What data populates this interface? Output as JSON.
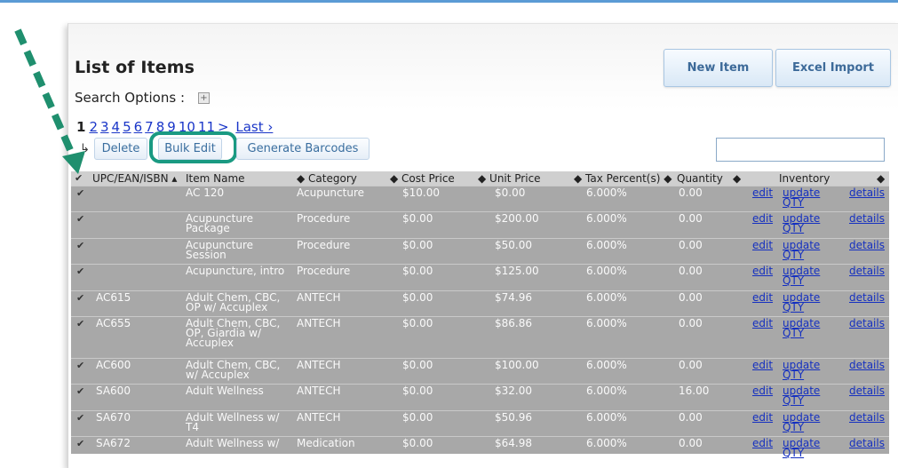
{
  "page": {
    "title": "List of Items",
    "search_options_label": "Search Options :",
    "search_toggle": "+",
    "new_item_button": "New Item",
    "excel_import_button": "Excel Import",
    "search_value": ""
  },
  "pagination": {
    "current": "1",
    "pages": [
      "2",
      "3",
      "4",
      "5",
      "6",
      "7",
      "8",
      "9",
      "10",
      "11"
    ],
    "next": ">",
    "last": "Last ›"
  },
  "actions": {
    "delete": "Delete",
    "bulk_edit": "Bulk Edit",
    "generate_barcodes": "Generate Barcodes"
  },
  "table": {
    "headers": {
      "check": "✔",
      "upc": "UPC/EAN/ISBN ▴",
      "item_name": "Item Name",
      "category": "◆ Category",
      "cost_price": "◆ Cost Price",
      "unit_price": "◆ Unit Price",
      "tax": "◆ Tax Percent(s) ◆",
      "quantity": "Quantity",
      "quantity_sort": "◆",
      "inventory": "Inventory",
      "inventory_sort": "◆"
    },
    "link_labels": {
      "edit": "edit",
      "update": "update",
      "qty": "QTY",
      "details": "details"
    },
    "rows": [
      {
        "upc": "",
        "name1": "AC 120",
        "name2": "",
        "name3": "",
        "category": "Acupuncture",
        "cost": "$10.00",
        "unit": "$0.00",
        "tax": "6.000%",
        "qty": "0.00"
      },
      {
        "upc": "",
        "name1": "Acupuncture",
        "name2": "Package",
        "name3": "",
        "category": "Procedure",
        "cost": "$0.00",
        "unit": "$200.00",
        "tax": "6.000%",
        "qty": "0.00"
      },
      {
        "upc": "",
        "name1": "Acupuncture",
        "name2": "Session",
        "name3": "",
        "category": "Procedure",
        "cost": "$0.00",
        "unit": "$50.00",
        "tax": "6.000%",
        "qty": "0.00"
      },
      {
        "upc": "",
        "name1": "Acupuncture, intro",
        "name2": "",
        "name3": "",
        "category": "Procedure",
        "cost": "$0.00",
        "unit": "$125.00",
        "tax": "6.000%",
        "qty": "0.00"
      },
      {
        "upc": "AC615",
        "name1": "Adult Chem, CBC,",
        "name2": "OP w/ Accuplex",
        "name3": "",
        "category": "ANTECH",
        "cost": "$0.00",
        "unit": "$74.96",
        "tax": "6.000%",
        "qty": "0.00"
      },
      {
        "upc": "AC655",
        "name1": "Adult Chem, CBC,",
        "name2": "OP, Giardia w/",
        "name3": "Accuplex",
        "category": "ANTECH",
        "cost": "$0.00",
        "unit": "$86.86",
        "tax": "6.000%",
        "qty": "0.00"
      },
      {
        "upc": "AC600",
        "name1": "Adult Chem, CBC,",
        "name2": "w/ Accuplex",
        "name3": "",
        "category": "ANTECH",
        "cost": "$0.00",
        "unit": "$100.00",
        "tax": "6.000%",
        "qty": "0.00"
      },
      {
        "upc": "SA600",
        "name1": "Adult Wellness",
        "name2": "",
        "name3": "",
        "category": "ANTECH",
        "cost": "$0.00",
        "unit": "$32.00",
        "tax": "6.000%",
        "qty": "16.00"
      },
      {
        "upc": "SA670",
        "name1": "Adult Wellness w/",
        "name2": "T4",
        "name3": "",
        "category": "ANTECH",
        "cost": "$0.00",
        "unit": "$50.96",
        "tax": "6.000%",
        "qty": "0.00"
      },
      {
        "upc": "SA672",
        "name1": "Adult Wellness w/",
        "name2": "",
        "name3": "",
        "category": "Medication",
        "cost": "$0.00",
        "unit": "$64.98",
        "tax": "6.000%",
        "qty": "0.00"
      }
    ]
  },
  "colors": {
    "highlight_ring": "#1a9a82",
    "arrow": "#1f8f6e",
    "row_bg": "#a8a8a8",
    "link": "#1530c0"
  }
}
